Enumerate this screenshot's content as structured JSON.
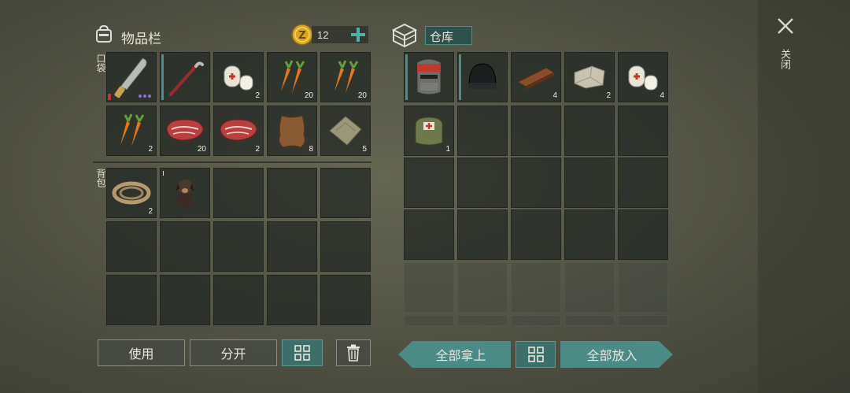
{
  "inventory": {
    "title": "物品栏",
    "coins": "12",
    "pocket_label": "口袋",
    "backpack_label": "背包",
    "pocket_slots": [
      {
        "item": "machete",
        "count": ""
      },
      {
        "item": "crowbar",
        "count": ""
      },
      {
        "item": "bandage",
        "count": "2"
      },
      {
        "item": "carrot",
        "count": "20"
      },
      {
        "item": "carrot",
        "count": "20"
      },
      {
        "item": "carrot",
        "count": "2"
      },
      {
        "item": "raw-meat",
        "count": "20"
      },
      {
        "item": "raw-meat",
        "count": "2"
      },
      {
        "item": "leather",
        "count": "8"
      },
      {
        "item": "cloth",
        "count": "5"
      }
    ],
    "backpack_slots": [
      {
        "item": "rope",
        "count": "2"
      },
      {
        "item": "puppy",
        "count": ""
      }
    ]
  },
  "storage": {
    "title": "仓库",
    "slots": [
      {
        "item": "iron-helmet",
        "count": ""
      },
      {
        "item": "beanie",
        "count": ""
      },
      {
        "item": "wood-plank",
        "count": "4"
      },
      {
        "item": "stone",
        "count": "2"
      },
      {
        "item": "bandage",
        "count": "4"
      },
      {
        "item": "medkit",
        "count": "1"
      }
    ]
  },
  "close_label": "关闭",
  "buttons": {
    "use": "使用",
    "split": "分开",
    "take_all": "全部拿上",
    "put_all": "全部放入"
  },
  "colors": {
    "accent_teal": "#3c6e6a",
    "coin_gold": "#d9a520"
  }
}
